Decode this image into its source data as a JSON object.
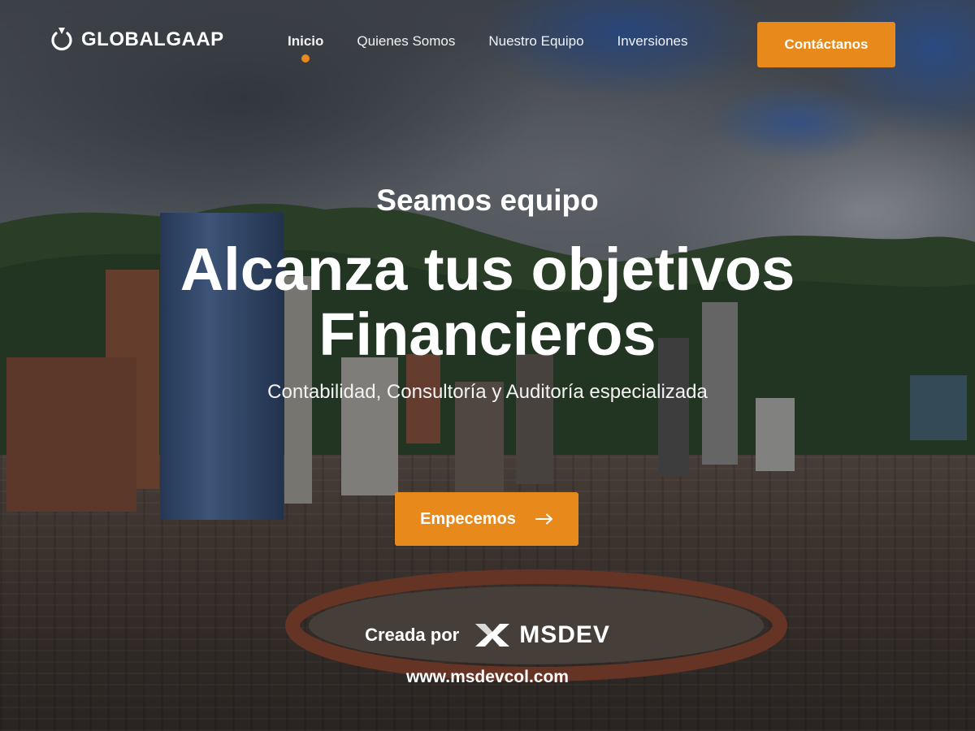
{
  "brand": {
    "name": "GLOBALGAAP",
    "logo_icon": "power-ring-icon"
  },
  "nav": {
    "items": [
      {
        "label": "Inicio",
        "active": true
      },
      {
        "label": "Quienes Somos",
        "active": false
      },
      {
        "label": "Nuestro Equipo",
        "active": false
      },
      {
        "label": "Inversiones",
        "active": false
      }
    ]
  },
  "header": {
    "contact_label": "Contáctanos"
  },
  "hero": {
    "eyebrow": "Seamos equipo",
    "headline_line1": "Alcanza tus objetivos",
    "headline_line2": "Financieros",
    "subtitle": "Contabilidad, Consultoría y Auditoría  especializada",
    "cta_label": "Empecemos",
    "cta_icon": "arrow-right-icon"
  },
  "credit": {
    "label": "Creada por",
    "company": "MSDEV",
    "company_icon": "msdev-logo-icon",
    "url": "www.msdevcol.com"
  },
  "colors": {
    "accent": "#e8891c",
    "text": "#ffffff"
  }
}
